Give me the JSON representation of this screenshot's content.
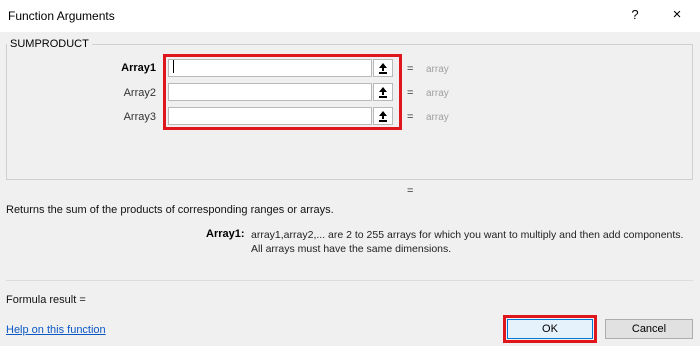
{
  "window": {
    "title": "Function Arguments",
    "help_glyph": "?",
    "close_glyph": "×"
  },
  "function": {
    "name": "SUMPRODUCT",
    "args": [
      {
        "label": "Array1",
        "value": "",
        "result_eq": "=",
        "result": "array",
        "bold": true
      },
      {
        "label": "Array2",
        "value": "",
        "result_eq": "=",
        "result": "array",
        "bold": false
      },
      {
        "label": "Array3",
        "value": "",
        "result_eq": "=",
        "result": "array",
        "bold": false
      }
    ],
    "overall_eq": "=",
    "description": "Returns the sum of the products of corresponding ranges or arrays.",
    "arg_help_label": "Array1:",
    "arg_help_text": "array1,array2,... are 2 to 255 arrays for which you want to multiply and then add components. All arrays must have the same dimensions."
  },
  "footer": {
    "formula_result": "Formula result =",
    "help_link": "Help on this function",
    "ok_label": "OK",
    "cancel_label": "Cancel"
  },
  "colors": {
    "highlight": "#e0161d",
    "link": "#0b58c5"
  }
}
